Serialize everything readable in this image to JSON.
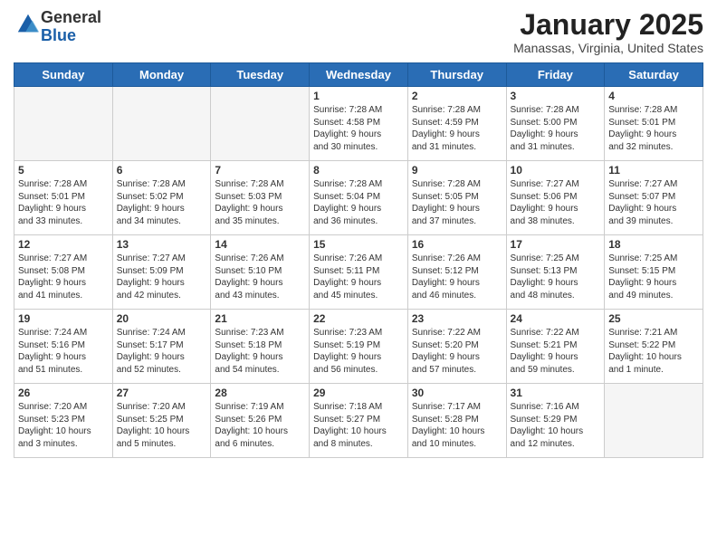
{
  "logo": {
    "general": "General",
    "blue": "Blue"
  },
  "title": "January 2025",
  "location": "Manassas, Virginia, United States",
  "days_header": [
    "Sunday",
    "Monday",
    "Tuesday",
    "Wednesday",
    "Thursday",
    "Friday",
    "Saturday"
  ],
  "weeks": [
    [
      {
        "num": "",
        "info": ""
      },
      {
        "num": "",
        "info": ""
      },
      {
        "num": "",
        "info": ""
      },
      {
        "num": "1",
        "info": "Sunrise: 7:28 AM\nSunset: 4:58 PM\nDaylight: 9 hours\nand 30 minutes."
      },
      {
        "num": "2",
        "info": "Sunrise: 7:28 AM\nSunset: 4:59 PM\nDaylight: 9 hours\nand 31 minutes."
      },
      {
        "num": "3",
        "info": "Sunrise: 7:28 AM\nSunset: 5:00 PM\nDaylight: 9 hours\nand 31 minutes."
      },
      {
        "num": "4",
        "info": "Sunrise: 7:28 AM\nSunset: 5:01 PM\nDaylight: 9 hours\nand 32 minutes."
      }
    ],
    [
      {
        "num": "5",
        "info": "Sunrise: 7:28 AM\nSunset: 5:01 PM\nDaylight: 9 hours\nand 33 minutes."
      },
      {
        "num": "6",
        "info": "Sunrise: 7:28 AM\nSunset: 5:02 PM\nDaylight: 9 hours\nand 34 minutes."
      },
      {
        "num": "7",
        "info": "Sunrise: 7:28 AM\nSunset: 5:03 PM\nDaylight: 9 hours\nand 35 minutes."
      },
      {
        "num": "8",
        "info": "Sunrise: 7:28 AM\nSunset: 5:04 PM\nDaylight: 9 hours\nand 36 minutes."
      },
      {
        "num": "9",
        "info": "Sunrise: 7:28 AM\nSunset: 5:05 PM\nDaylight: 9 hours\nand 37 minutes."
      },
      {
        "num": "10",
        "info": "Sunrise: 7:27 AM\nSunset: 5:06 PM\nDaylight: 9 hours\nand 38 minutes."
      },
      {
        "num": "11",
        "info": "Sunrise: 7:27 AM\nSunset: 5:07 PM\nDaylight: 9 hours\nand 39 minutes."
      }
    ],
    [
      {
        "num": "12",
        "info": "Sunrise: 7:27 AM\nSunset: 5:08 PM\nDaylight: 9 hours\nand 41 minutes."
      },
      {
        "num": "13",
        "info": "Sunrise: 7:27 AM\nSunset: 5:09 PM\nDaylight: 9 hours\nand 42 minutes."
      },
      {
        "num": "14",
        "info": "Sunrise: 7:26 AM\nSunset: 5:10 PM\nDaylight: 9 hours\nand 43 minutes."
      },
      {
        "num": "15",
        "info": "Sunrise: 7:26 AM\nSunset: 5:11 PM\nDaylight: 9 hours\nand 45 minutes."
      },
      {
        "num": "16",
        "info": "Sunrise: 7:26 AM\nSunset: 5:12 PM\nDaylight: 9 hours\nand 46 minutes."
      },
      {
        "num": "17",
        "info": "Sunrise: 7:25 AM\nSunset: 5:13 PM\nDaylight: 9 hours\nand 48 minutes."
      },
      {
        "num": "18",
        "info": "Sunrise: 7:25 AM\nSunset: 5:15 PM\nDaylight: 9 hours\nand 49 minutes."
      }
    ],
    [
      {
        "num": "19",
        "info": "Sunrise: 7:24 AM\nSunset: 5:16 PM\nDaylight: 9 hours\nand 51 minutes."
      },
      {
        "num": "20",
        "info": "Sunrise: 7:24 AM\nSunset: 5:17 PM\nDaylight: 9 hours\nand 52 minutes."
      },
      {
        "num": "21",
        "info": "Sunrise: 7:23 AM\nSunset: 5:18 PM\nDaylight: 9 hours\nand 54 minutes."
      },
      {
        "num": "22",
        "info": "Sunrise: 7:23 AM\nSunset: 5:19 PM\nDaylight: 9 hours\nand 56 minutes."
      },
      {
        "num": "23",
        "info": "Sunrise: 7:22 AM\nSunset: 5:20 PM\nDaylight: 9 hours\nand 57 minutes."
      },
      {
        "num": "24",
        "info": "Sunrise: 7:22 AM\nSunset: 5:21 PM\nDaylight: 9 hours\nand 59 minutes."
      },
      {
        "num": "25",
        "info": "Sunrise: 7:21 AM\nSunset: 5:22 PM\nDaylight: 10 hours\nand 1 minute."
      }
    ],
    [
      {
        "num": "26",
        "info": "Sunrise: 7:20 AM\nSunset: 5:23 PM\nDaylight: 10 hours\nand 3 minutes."
      },
      {
        "num": "27",
        "info": "Sunrise: 7:20 AM\nSunset: 5:25 PM\nDaylight: 10 hours\nand 5 minutes."
      },
      {
        "num": "28",
        "info": "Sunrise: 7:19 AM\nSunset: 5:26 PM\nDaylight: 10 hours\nand 6 minutes."
      },
      {
        "num": "29",
        "info": "Sunrise: 7:18 AM\nSunset: 5:27 PM\nDaylight: 10 hours\nand 8 minutes."
      },
      {
        "num": "30",
        "info": "Sunrise: 7:17 AM\nSunset: 5:28 PM\nDaylight: 10 hours\nand 10 minutes."
      },
      {
        "num": "31",
        "info": "Sunrise: 7:16 AM\nSunset: 5:29 PM\nDaylight: 10 hours\nand 12 minutes."
      },
      {
        "num": "",
        "info": ""
      }
    ]
  ]
}
